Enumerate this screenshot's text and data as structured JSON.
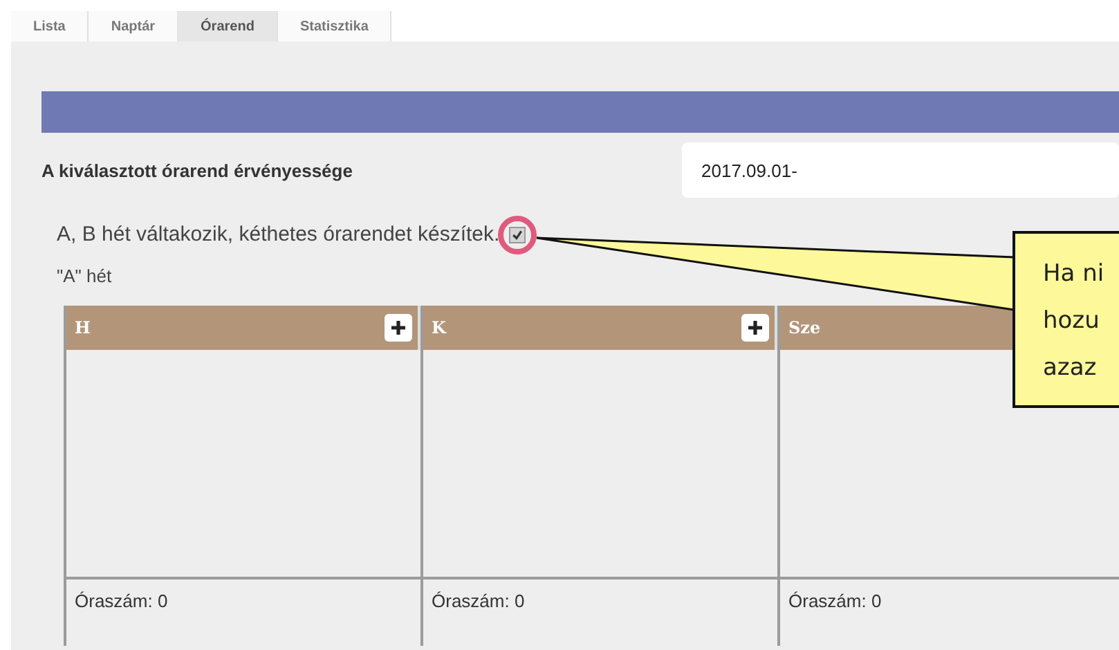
{
  "tabs": [
    {
      "label": "Lista",
      "selected": false
    },
    {
      "label": "Naptár",
      "selected": false
    },
    {
      "label": "Órarend",
      "selected": true
    },
    {
      "label": "Statisztika",
      "selected": false
    }
  ],
  "validity": {
    "label": "A kiválasztott órarend érvényessége",
    "value": "2017.09.01-"
  },
  "alternating": {
    "label": "A, B hét váltakozik, kéthetes órarendet készítek.",
    "checked": true
  },
  "week_title": "\"A\" hét",
  "days": [
    {
      "name": "H",
      "add_button": true,
      "footer": "Óraszám: 0"
    },
    {
      "name": "K",
      "add_button": true,
      "footer": "Óraszám: 0"
    },
    {
      "name": "Sze",
      "footer": "Óraszám: 0"
    }
  ],
  "callout": {
    "lines": [
      "Ha ni",
      "hozu",
      "azaz"
    ]
  }
}
